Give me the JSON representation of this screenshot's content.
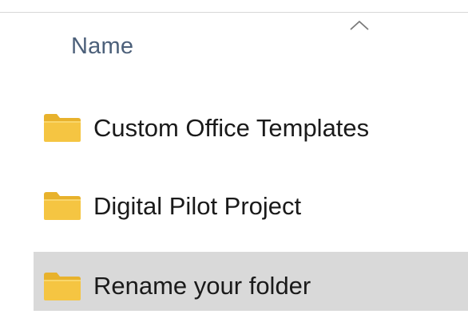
{
  "header": {
    "name_column": "Name",
    "sort_icon": "chevron-up-icon",
    "sort_direction": "ascending"
  },
  "items": [
    {
      "label": "Custom Office Templates",
      "icon": "folder-icon",
      "selected": false
    },
    {
      "label": "Digital Pilot Project",
      "icon": "folder-icon",
      "selected": false
    },
    {
      "label": "Rename your folder",
      "icon": "folder-icon",
      "selected": true
    }
  ],
  "colors": {
    "header_text": "#4c607a",
    "item_text": "#1a1a1a",
    "selection_background": "#d9d9d9",
    "folder_body": "#f5c542",
    "folder_tab": "#e8b22c"
  }
}
